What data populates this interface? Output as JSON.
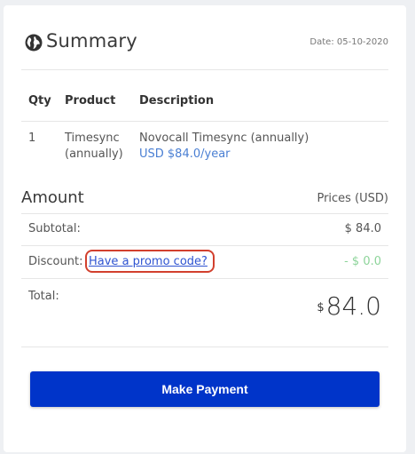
{
  "header": {
    "title": "Summary",
    "date_text": "Date: 05-10-2020"
  },
  "table": {
    "columns": [
      "Qty",
      "Product",
      "Description"
    ],
    "rows": [
      {
        "qty": "1",
        "product_line1": "Timesync",
        "product_line2": "(annually)",
        "description": "Novocall Timesync (annually)",
        "price": "USD $84.0/year"
      }
    ]
  },
  "amount": {
    "title": "Amount",
    "currency_label": "Prices (USD)",
    "subtotal_label": "Subtotal:",
    "subtotal_value": "$ 84.0",
    "discount_label": "Discount:",
    "promo_link": "Have a promo code?",
    "discount_value": "- $ 0.0",
    "total_label": "Total:",
    "total_symbol": "$",
    "total_value": "84.0"
  },
  "actions": {
    "pay_label": "Make Payment"
  },
  "colors": {
    "primary_button": "#0034c9",
    "link": "#2f54d1",
    "price_text": "#4a7fd3",
    "discount_text": "#8dd49a",
    "highlight_ring": "#d2402e"
  }
}
